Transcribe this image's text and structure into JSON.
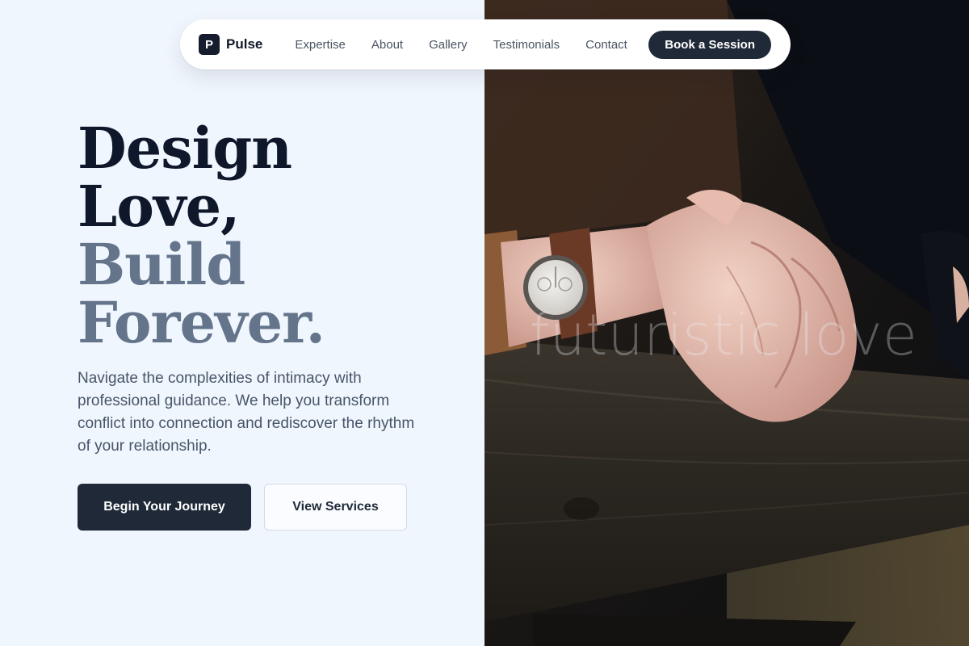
{
  "brand": {
    "logo_letter": "P",
    "name": "Pulse"
  },
  "nav": {
    "links": [
      "Expertise",
      "About",
      "Gallery",
      "Testimonials",
      "Contact"
    ],
    "cta": "Book a Session"
  },
  "hero": {
    "headline_lines": [
      "Design",
      "Love,",
      "Build",
      "Forever."
    ],
    "lead": "Navigate the complexities of intimacy with professional guidance. We help you transform conflict into connection and rediscover the rhythm of your relationship.",
    "primary_button": "Begin Your Journey",
    "secondary_button": "View Services"
  },
  "image": {
    "watermark": "futuristic love"
  },
  "colors": {
    "page_bg": "#f0f6fd",
    "dark": "#0f172a",
    "muted": "#64748b",
    "button_dark": "#1f2937"
  }
}
